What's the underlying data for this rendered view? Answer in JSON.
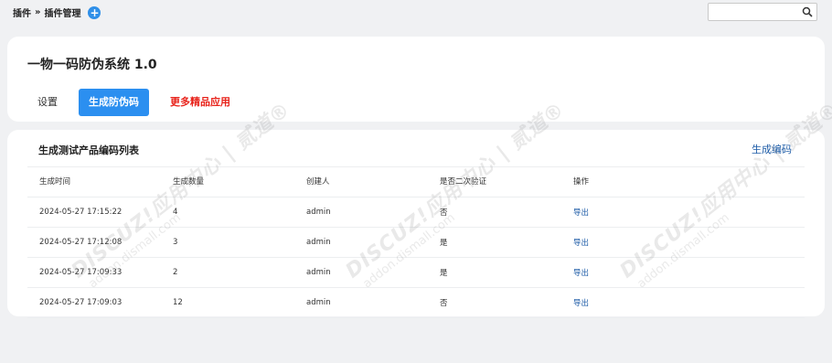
{
  "breadcrumb": {
    "root": "插件",
    "separator": "»",
    "current": "插件管理",
    "add_icon": "plus-circle-icon"
  },
  "search": {
    "value": "",
    "placeholder": "",
    "icon": "search-icon"
  },
  "app": {
    "title": "一物一码防伪系统 1.0"
  },
  "tabs": [
    {
      "label": "设置",
      "active": false
    },
    {
      "label": "生成防伪码",
      "active": true
    },
    {
      "label": "更多精品应用",
      "active": false
    }
  ],
  "list": {
    "title": "生成测试产品编码列表",
    "generate_link": "生成编码",
    "columns": [
      "生成时间",
      "生成数量",
      "创建人",
      "是否二次验证",
      "操作"
    ],
    "rows": [
      {
        "time": "2024-05-27 17:15:22",
        "count": "4",
        "creator": "admin",
        "second_verify": "否",
        "action": "导出"
      },
      {
        "time": "2024-05-27 17:12:08",
        "count": "3",
        "creator": "admin",
        "second_verify": "是",
        "action": "导出"
      },
      {
        "time": "2024-05-27 17:09:33",
        "count": "2",
        "creator": "admin",
        "second_verify": "是",
        "action": "导出"
      },
      {
        "time": "2024-05-27 17:09:03",
        "count": "12",
        "creator": "admin",
        "second_verify": "否",
        "action": "导出"
      }
    ]
  },
  "watermark": {
    "brand": "DISCUZ!应用中心 | 贰道®",
    "url": "addon.dismall.com"
  },
  "colors": {
    "accent": "#2b8ff0",
    "link": "#1b5aa6",
    "highlight": "#e8241c",
    "background": "#f0f1f3"
  }
}
